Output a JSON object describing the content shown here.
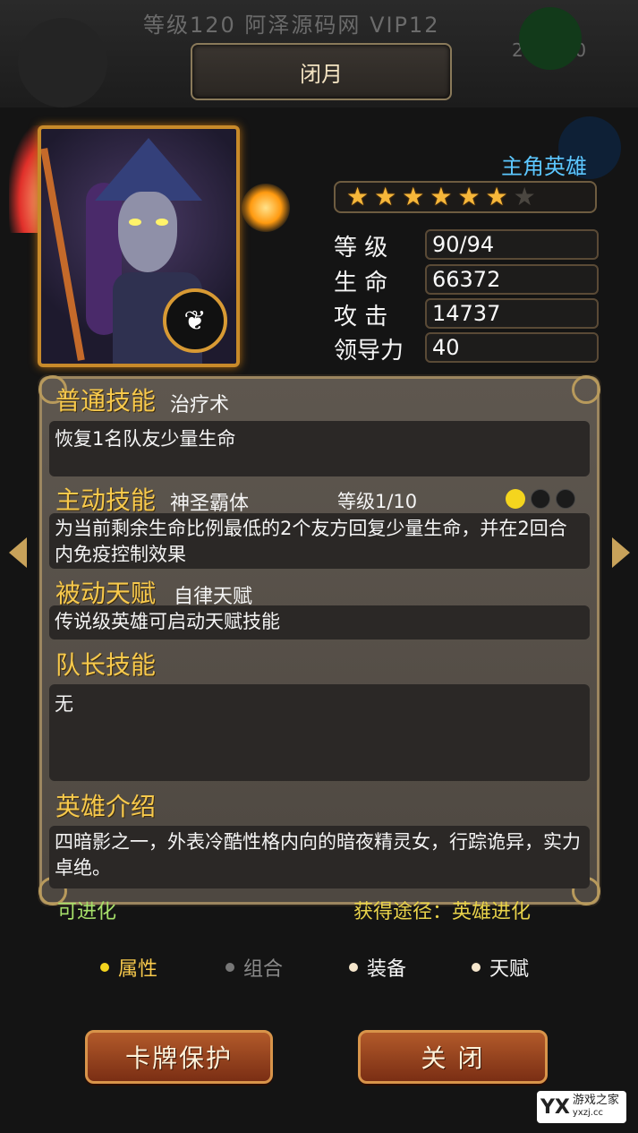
{
  "background": {
    "title": "等级120   阿泽源码网   VIP12",
    "energy": "200/200"
  },
  "hero": {
    "name": "闭月",
    "type": "主角英雄",
    "stars_total": 7,
    "stars_filled": 6
  },
  "stats": [
    {
      "label": "等  级",
      "value": "90/94"
    },
    {
      "label": "生  命",
      "value": "66372"
    },
    {
      "label": "攻  击",
      "value": "14737"
    },
    {
      "label": "领导力",
      "value": "40"
    }
  ],
  "skills": {
    "normal": {
      "title": "普通技能",
      "name": "治疗术",
      "desc": "恢复1名队友少量生命"
    },
    "active": {
      "title": "主动技能",
      "name": "神圣霸体",
      "level": "等级1/10",
      "level_value": 1,
      "level_max": 10,
      "desc": "为当前剩余生命比例最低的2个友方回复少量生命，并在2回合内免疫控制效果"
    },
    "passive": {
      "title": "被动天赋",
      "name": "自律天赋",
      "desc": "传说级英雄可启动天赋技能"
    },
    "captain": {
      "title": "队长技能",
      "desc": "无"
    },
    "intro": {
      "title": "英雄介绍",
      "desc": "四暗影之一，外表冷酷性格内向的暗夜精灵女，行踪诡异，实力卓绝。"
    }
  },
  "footer": {
    "evolve": "可进化",
    "source": "获得途径：英雄进化"
  },
  "tabs": [
    {
      "label": "属性",
      "active": true
    },
    {
      "label": "组合",
      "active": false
    },
    {
      "label": "装备",
      "active": false
    },
    {
      "label": "天赋",
      "active": false
    }
  ],
  "buttons": {
    "protect": "卡牌保护",
    "close": "关  闭"
  },
  "watermark": {
    "mark": "YX",
    "text": "游戏之家",
    "sub": "yxzj.cc"
  },
  "colors": {
    "accent_gold": "#f7c94c",
    "hero_type": "#5cc7ff",
    "evolve_green": "#a6e06a"
  }
}
